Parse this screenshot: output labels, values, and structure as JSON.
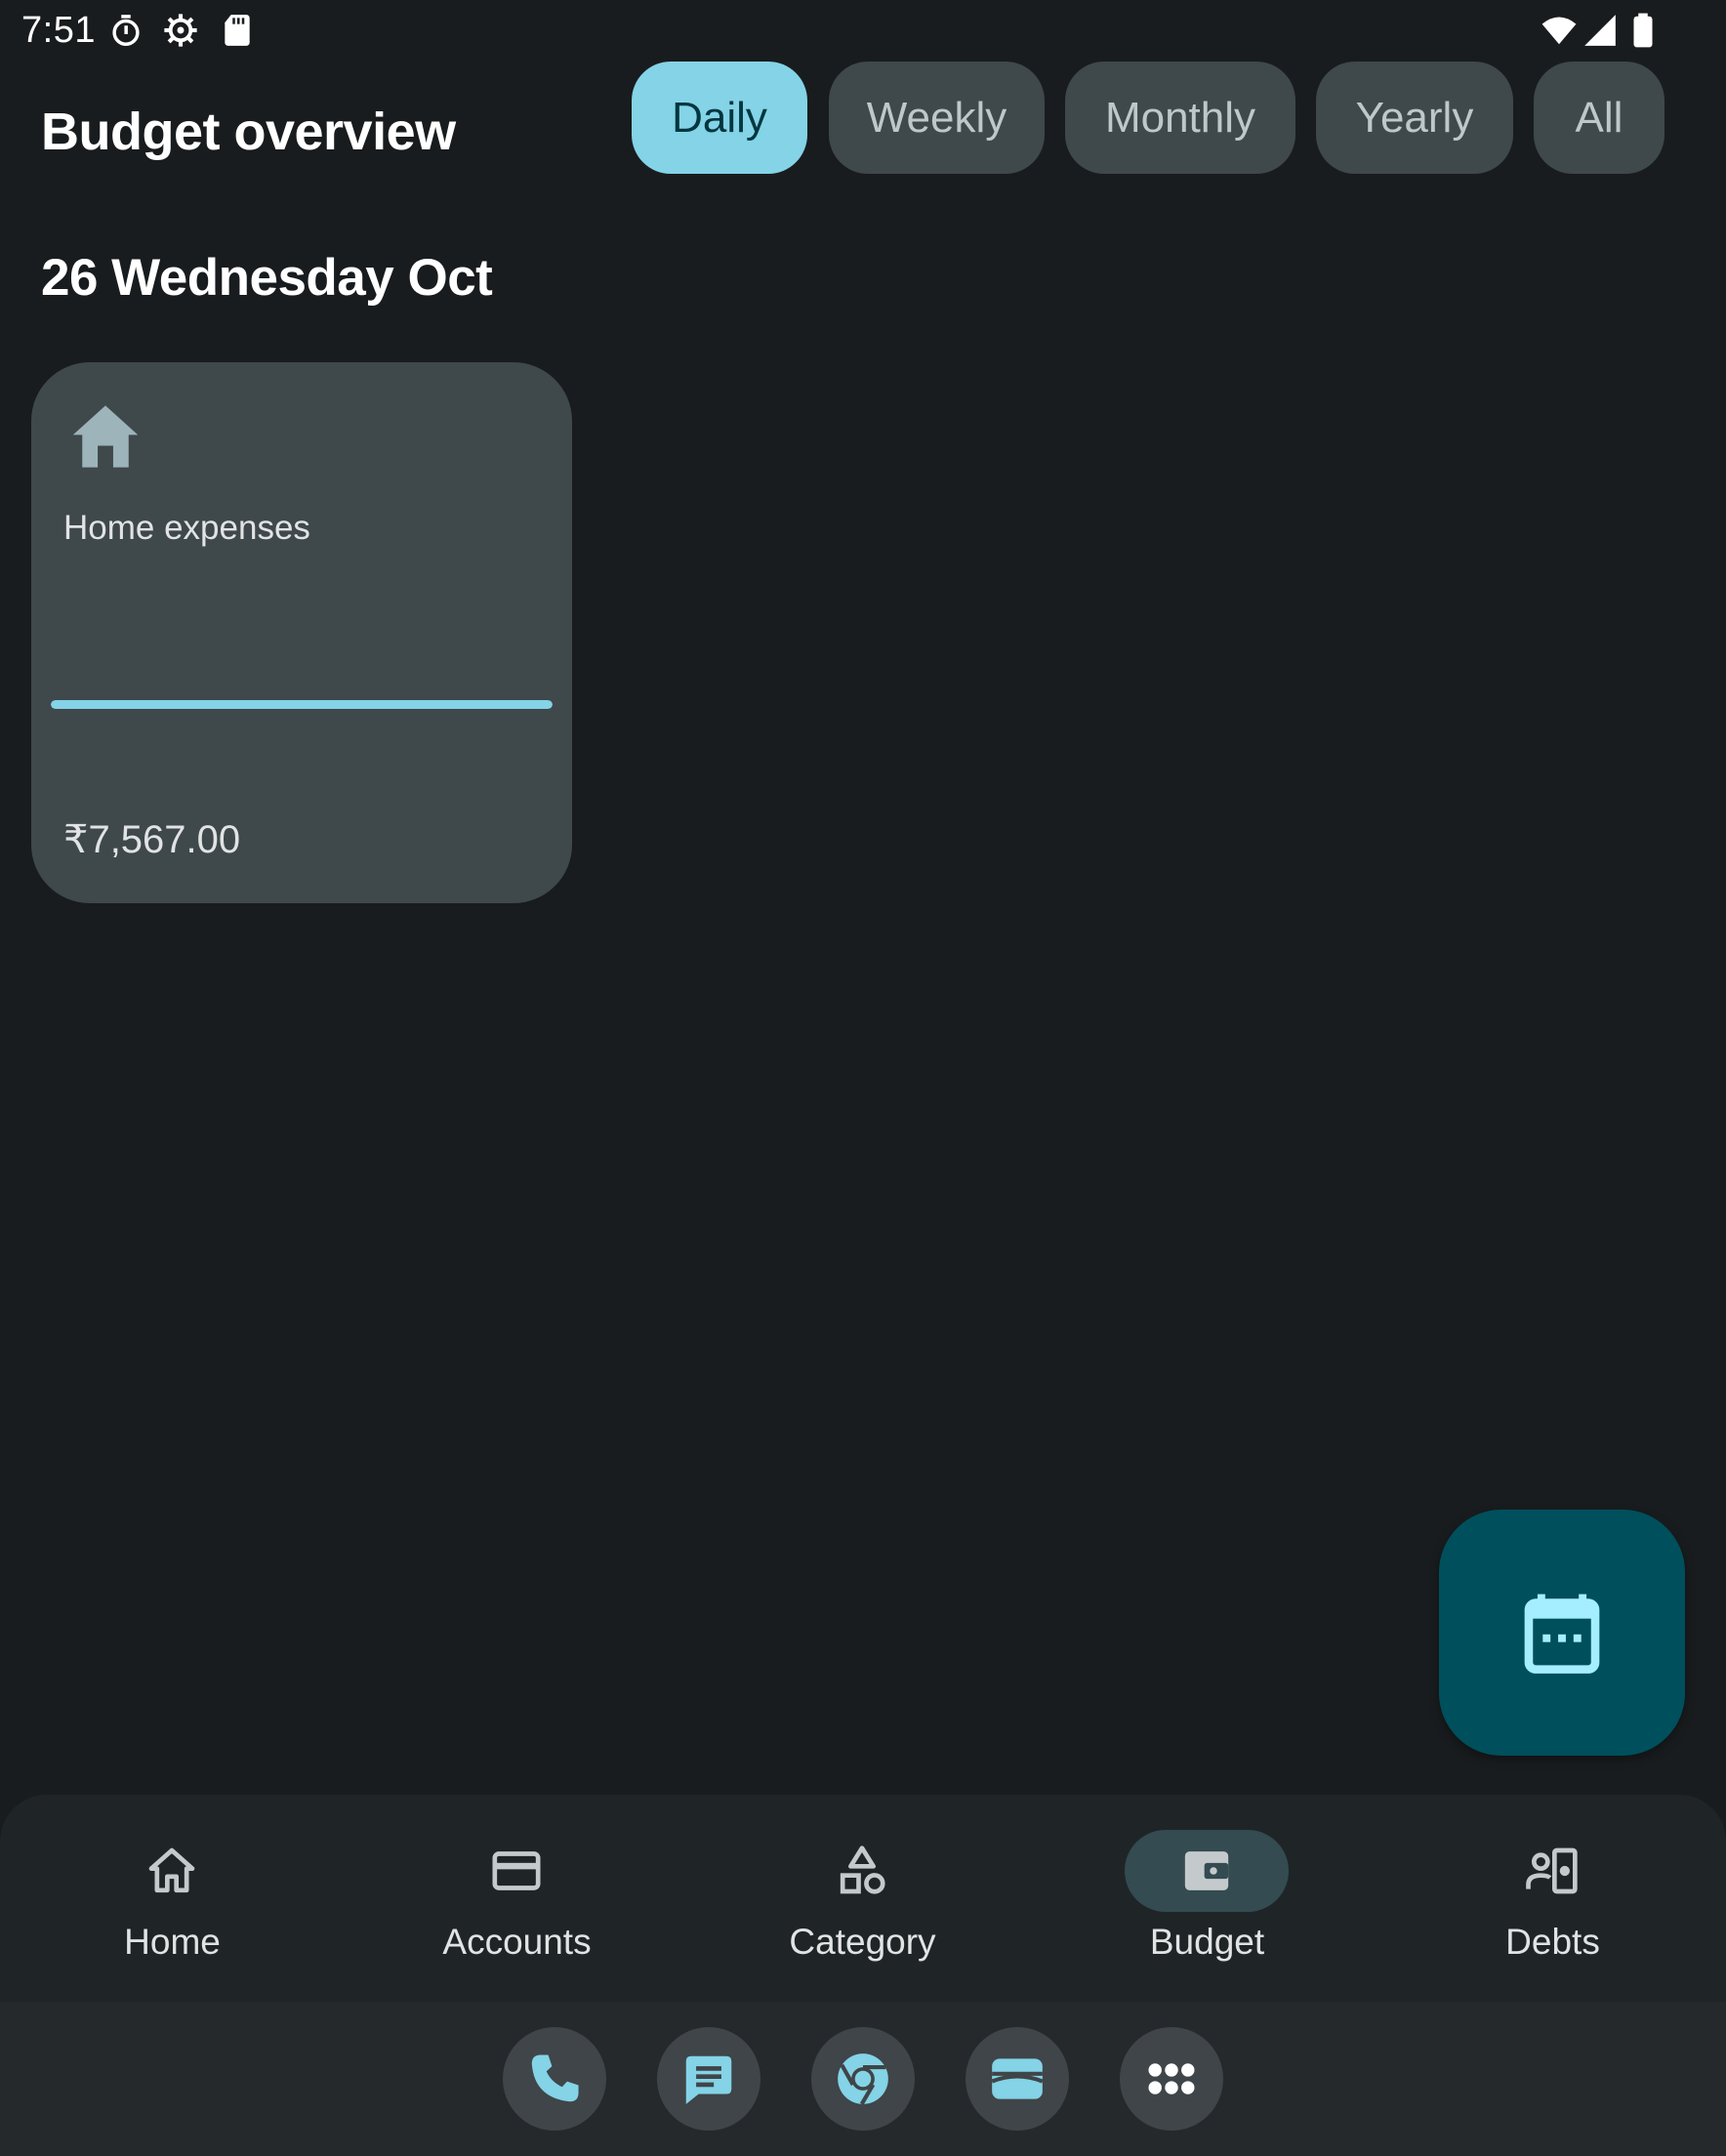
{
  "status_bar": {
    "time": "7:51",
    "left_icons": [
      "timer-icon",
      "settings-gear-icon",
      "sd-card-icon"
    ],
    "right_icons": [
      "wifi-icon",
      "cell-signal-icon",
      "battery-icon"
    ]
  },
  "header": {
    "title": "Budget overview",
    "filters": [
      {
        "label": "Daily",
        "selected": true
      },
      {
        "label": "Weekly",
        "selected": false
      },
      {
        "label": "Monthly",
        "selected": false
      },
      {
        "label": "Yearly",
        "selected": false
      },
      {
        "label": "All",
        "selected": false
      }
    ]
  },
  "date_heading": "26 Wednesday Oct",
  "budget_cards": [
    {
      "icon": "house-icon",
      "name": "Home expenses",
      "amount": "₹7,567.00",
      "progress": 1.0
    }
  ],
  "fab": {
    "icon": "calendar-icon"
  },
  "bottom_nav": {
    "items": [
      {
        "label": "Home",
        "icon": "home-outline-icon",
        "active": false
      },
      {
        "label": "Accounts",
        "icon": "credit-card-icon",
        "active": false
      },
      {
        "label": "Category",
        "icon": "shapes-icon",
        "active": false
      },
      {
        "label": "Budget",
        "icon": "wallet-icon",
        "active": true
      },
      {
        "label": "Debts",
        "icon": "debts-icon",
        "active": false
      }
    ]
  },
  "dock": {
    "apps": [
      "phone-icon",
      "messages-icon",
      "chrome-icon",
      "wallet-app-icon",
      "app-drawer-icon"
    ]
  },
  "colors": {
    "background": "#191c1e",
    "accent": "#84d3e6",
    "chip": "#3f484b",
    "card": "#3f484b",
    "fab": "#004f5c",
    "nav": "#1f2527"
  }
}
